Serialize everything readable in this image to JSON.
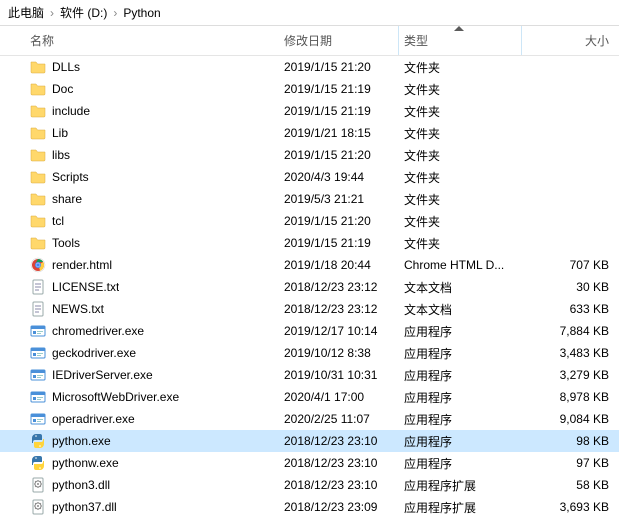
{
  "breadcrumb": {
    "root": "此电脑",
    "drive": "软件 (D:)",
    "folder": "Python"
  },
  "columns": {
    "name": "名称",
    "date": "修改日期",
    "type": "类型",
    "size": "大小"
  },
  "files": [
    {
      "icon": "folder",
      "name": "DLLs",
      "date": "2019/1/15 21:20",
      "type": "文件夹",
      "size": ""
    },
    {
      "icon": "folder",
      "name": "Doc",
      "date": "2019/1/15 21:19",
      "type": "文件夹",
      "size": ""
    },
    {
      "icon": "folder",
      "name": "include",
      "date": "2019/1/15 21:19",
      "type": "文件夹",
      "size": ""
    },
    {
      "icon": "folder",
      "name": "Lib",
      "date": "2019/1/21 18:15",
      "type": "文件夹",
      "size": ""
    },
    {
      "icon": "folder",
      "name": "libs",
      "date": "2019/1/15 21:20",
      "type": "文件夹",
      "size": ""
    },
    {
      "icon": "folder",
      "name": "Scripts",
      "date": "2020/4/3 19:44",
      "type": "文件夹",
      "size": ""
    },
    {
      "icon": "folder",
      "name": "share",
      "date": "2019/5/3 21:21",
      "type": "文件夹",
      "size": ""
    },
    {
      "icon": "folder",
      "name": "tcl",
      "date": "2019/1/15 21:20",
      "type": "文件夹",
      "size": ""
    },
    {
      "icon": "folder",
      "name": "Tools",
      "date": "2019/1/15 21:19",
      "type": "文件夹",
      "size": ""
    },
    {
      "icon": "chrome",
      "name": "render.html",
      "date": "2019/1/18 20:44",
      "type": "Chrome HTML D...",
      "size": "707 KB"
    },
    {
      "icon": "text",
      "name": "LICENSE.txt",
      "date": "2018/12/23 23:12",
      "type": "文本文档",
      "size": "30 KB"
    },
    {
      "icon": "text",
      "name": "NEWS.txt",
      "date": "2018/12/23 23:12",
      "type": "文本文档",
      "size": "633 KB"
    },
    {
      "icon": "exe",
      "name": "chromedriver.exe",
      "date": "2019/12/17 10:14",
      "type": "应用程序",
      "size": "7,884 KB"
    },
    {
      "icon": "exe",
      "name": "geckodriver.exe",
      "date": "2019/10/12 8:38",
      "type": "应用程序",
      "size": "3,483 KB"
    },
    {
      "icon": "exe",
      "name": "IEDriverServer.exe",
      "date": "2019/10/31 10:31",
      "type": "应用程序",
      "size": "3,279 KB"
    },
    {
      "icon": "exe",
      "name": "MicrosoftWebDriver.exe",
      "date": "2020/4/1 17:00",
      "type": "应用程序",
      "size": "8,978 KB"
    },
    {
      "icon": "exe",
      "name": "operadriver.exe",
      "date": "2020/2/25 11:07",
      "type": "应用程序",
      "size": "9,084 KB"
    },
    {
      "icon": "python",
      "name": "python.exe",
      "date": "2018/12/23 23:10",
      "type": "应用程序",
      "size": "98 KB",
      "selected": true
    },
    {
      "icon": "python",
      "name": "pythonw.exe",
      "date": "2018/12/23 23:10",
      "type": "应用程序",
      "size": "97 KB"
    },
    {
      "icon": "dll",
      "name": "python3.dll",
      "date": "2018/12/23 23:10",
      "type": "应用程序扩展",
      "size": "58 KB"
    },
    {
      "icon": "dll",
      "name": "python37.dll",
      "date": "2018/12/23 23:09",
      "type": "应用程序扩展",
      "size": "3,693 KB"
    }
  ]
}
